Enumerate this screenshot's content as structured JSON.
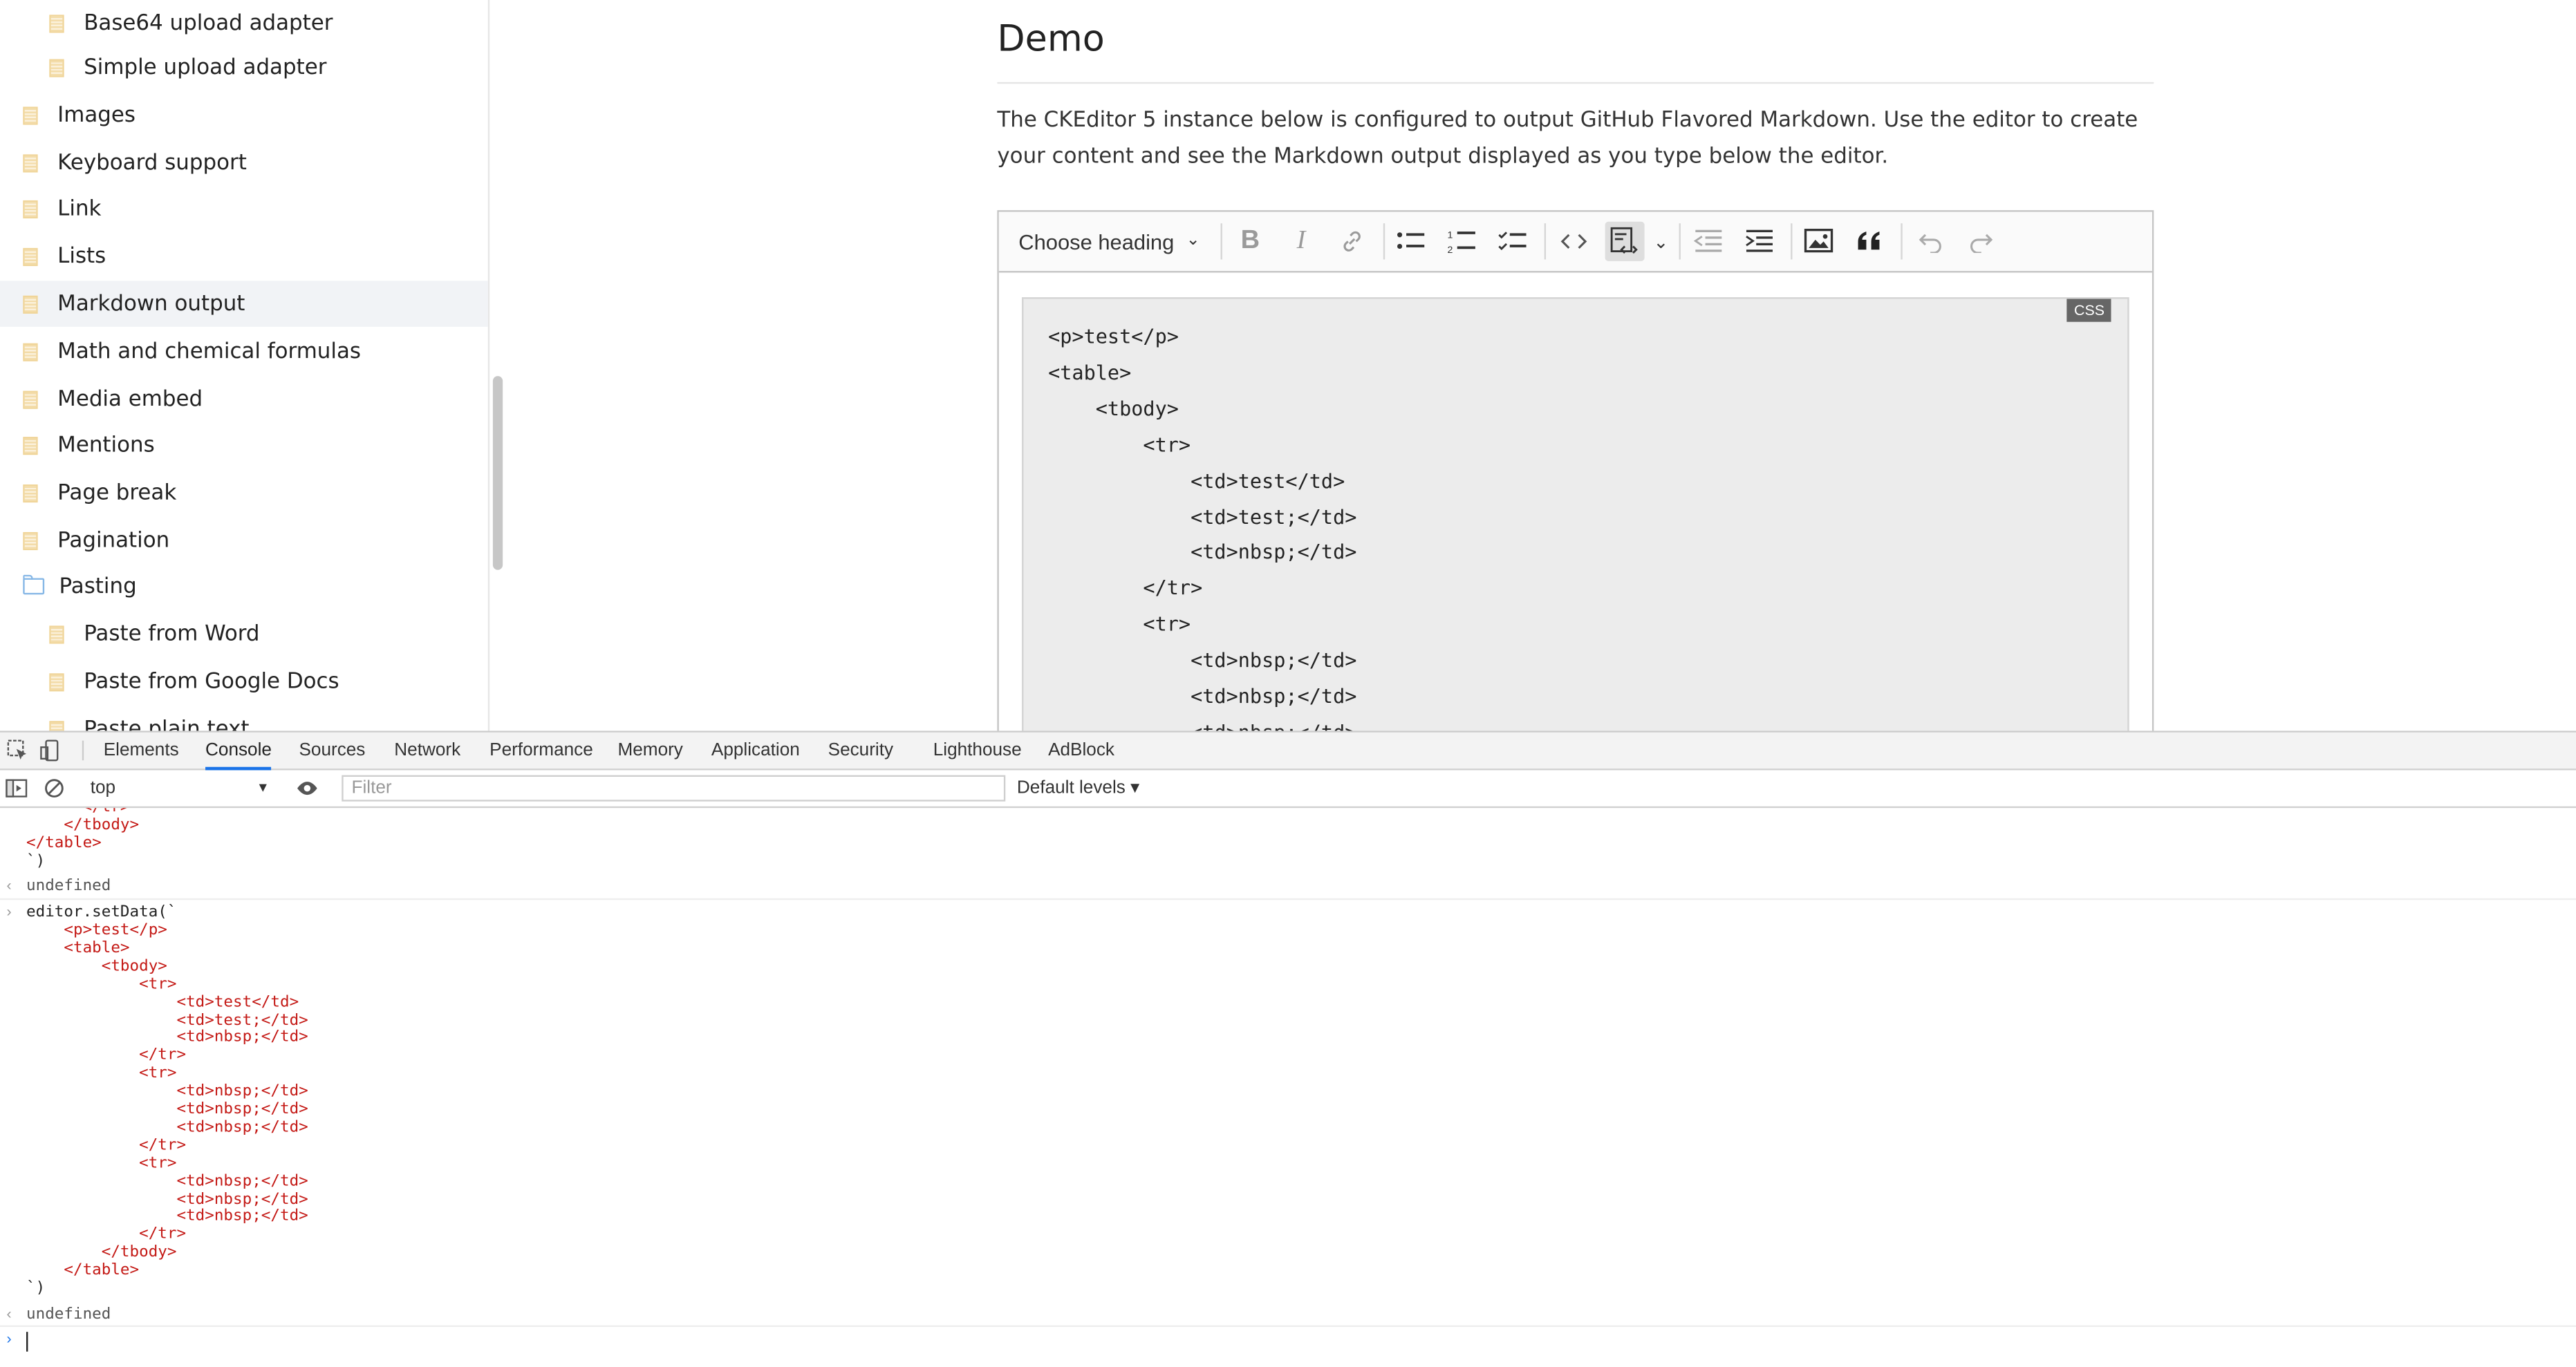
{
  "sidebar": {
    "items": [
      {
        "label": "Base64 upload adapter",
        "level": 2,
        "icon": "page-icon",
        "active": false
      },
      {
        "label": "Simple upload adapter",
        "level": 2,
        "icon": "page-icon",
        "active": false
      },
      {
        "label": "Images",
        "level": 1,
        "icon": "page-icon",
        "active": false
      },
      {
        "label": "Keyboard support",
        "level": 1,
        "icon": "page-icon",
        "active": false
      },
      {
        "label": "Link",
        "level": 1,
        "icon": "page-icon",
        "active": false
      },
      {
        "label": "Lists",
        "level": 1,
        "icon": "page-icon",
        "active": false
      },
      {
        "label": "Markdown output",
        "level": 1,
        "icon": "page-icon",
        "active": true
      },
      {
        "label": "Math and chemical formulas",
        "level": 1,
        "icon": "page-icon",
        "active": false
      },
      {
        "label": "Media embed",
        "level": 1,
        "icon": "page-icon",
        "active": false
      },
      {
        "label": "Mentions",
        "level": 1,
        "icon": "page-icon",
        "active": false
      },
      {
        "label": "Page break",
        "level": 1,
        "icon": "page-icon",
        "active": false
      },
      {
        "label": "Pagination",
        "level": 1,
        "icon": "page-icon",
        "active": false
      },
      {
        "label": "Pasting",
        "level": 1,
        "icon": "folder-icon",
        "active": false
      },
      {
        "label": "Paste from Word",
        "level": 2,
        "icon": "page-icon",
        "active": false
      },
      {
        "label": "Paste from Google Docs",
        "level": 2,
        "icon": "page-icon",
        "active": false
      },
      {
        "label": "Paste plain text",
        "level": 2,
        "icon": "page-icon",
        "active": false
      }
    ]
  },
  "main": {
    "title": "Demo",
    "intro": "The CKEditor 5 instance below is configured to output GitHub Flavored Markdown. Use the editor to create your content and see the Markdown output displayed as you type below the editor."
  },
  "editor": {
    "heading_label": "Choose heading",
    "toolbar_icons": [
      "bold-icon",
      "italic-icon",
      "link-icon",
      "bulleted-list-icon",
      "numbered-list-icon",
      "todo-list-icon",
      "code-icon",
      "code-block-icon",
      "chevron-down-icon",
      "outdent-icon",
      "indent-icon",
      "image-icon",
      "blockquote-icon",
      "undo-icon",
      "redo-icon"
    ],
    "code_language": "CSS",
    "code_lines": [
      "<p>test</p>",
      "<table>",
      "    <tbody>",
      "        <tr>",
      "            <td>test</td>",
      "            <td>test;</td>",
      "            <td>nbsp;</td>",
      "        </tr>",
      "        <tr>",
      "            <td>nbsp;</td>",
      "            <td>nbsp;</td>",
      "            <td>nbsp;</td>"
    ]
  },
  "devtools": {
    "tabs": [
      "Elements",
      "Console",
      "Sources",
      "Network",
      "Performance",
      "Memory",
      "Application",
      "Security",
      "Lighthouse",
      "AdBlock"
    ],
    "active_tab": "Console",
    "context": "top",
    "filter_placeholder": "Filter",
    "levels": "Default levels ▾",
    "console": {
      "prev_tail": [
        "      </tr>",
        "    </tbody>",
        "</table>",
        "`)"
      ],
      "result1": "undefined",
      "command_head": "editor.setData(`",
      "command_lines": [
        "    <p>test</p>",
        "    <table>",
        "        <tbody>",
        "            <tr>",
        "                <td>test</td>",
        "                <td>test;</td>",
        "                <td>nbsp;</td>",
        "            </tr>",
        "            <tr>",
        "                <td>nbsp;</td>",
        "                <td>nbsp;</td>",
        "                <td>nbsp;</td>",
        "            </tr>",
        "            <tr>",
        "                <td>nbsp;</td>",
        "                <td>nbsp;</td>",
        "                <td>nbsp;</td>",
        "            </tr>",
        "        </tbody>",
        "    </table>"
      ],
      "command_tail": "`)",
      "result2": "undefined"
    }
  }
}
